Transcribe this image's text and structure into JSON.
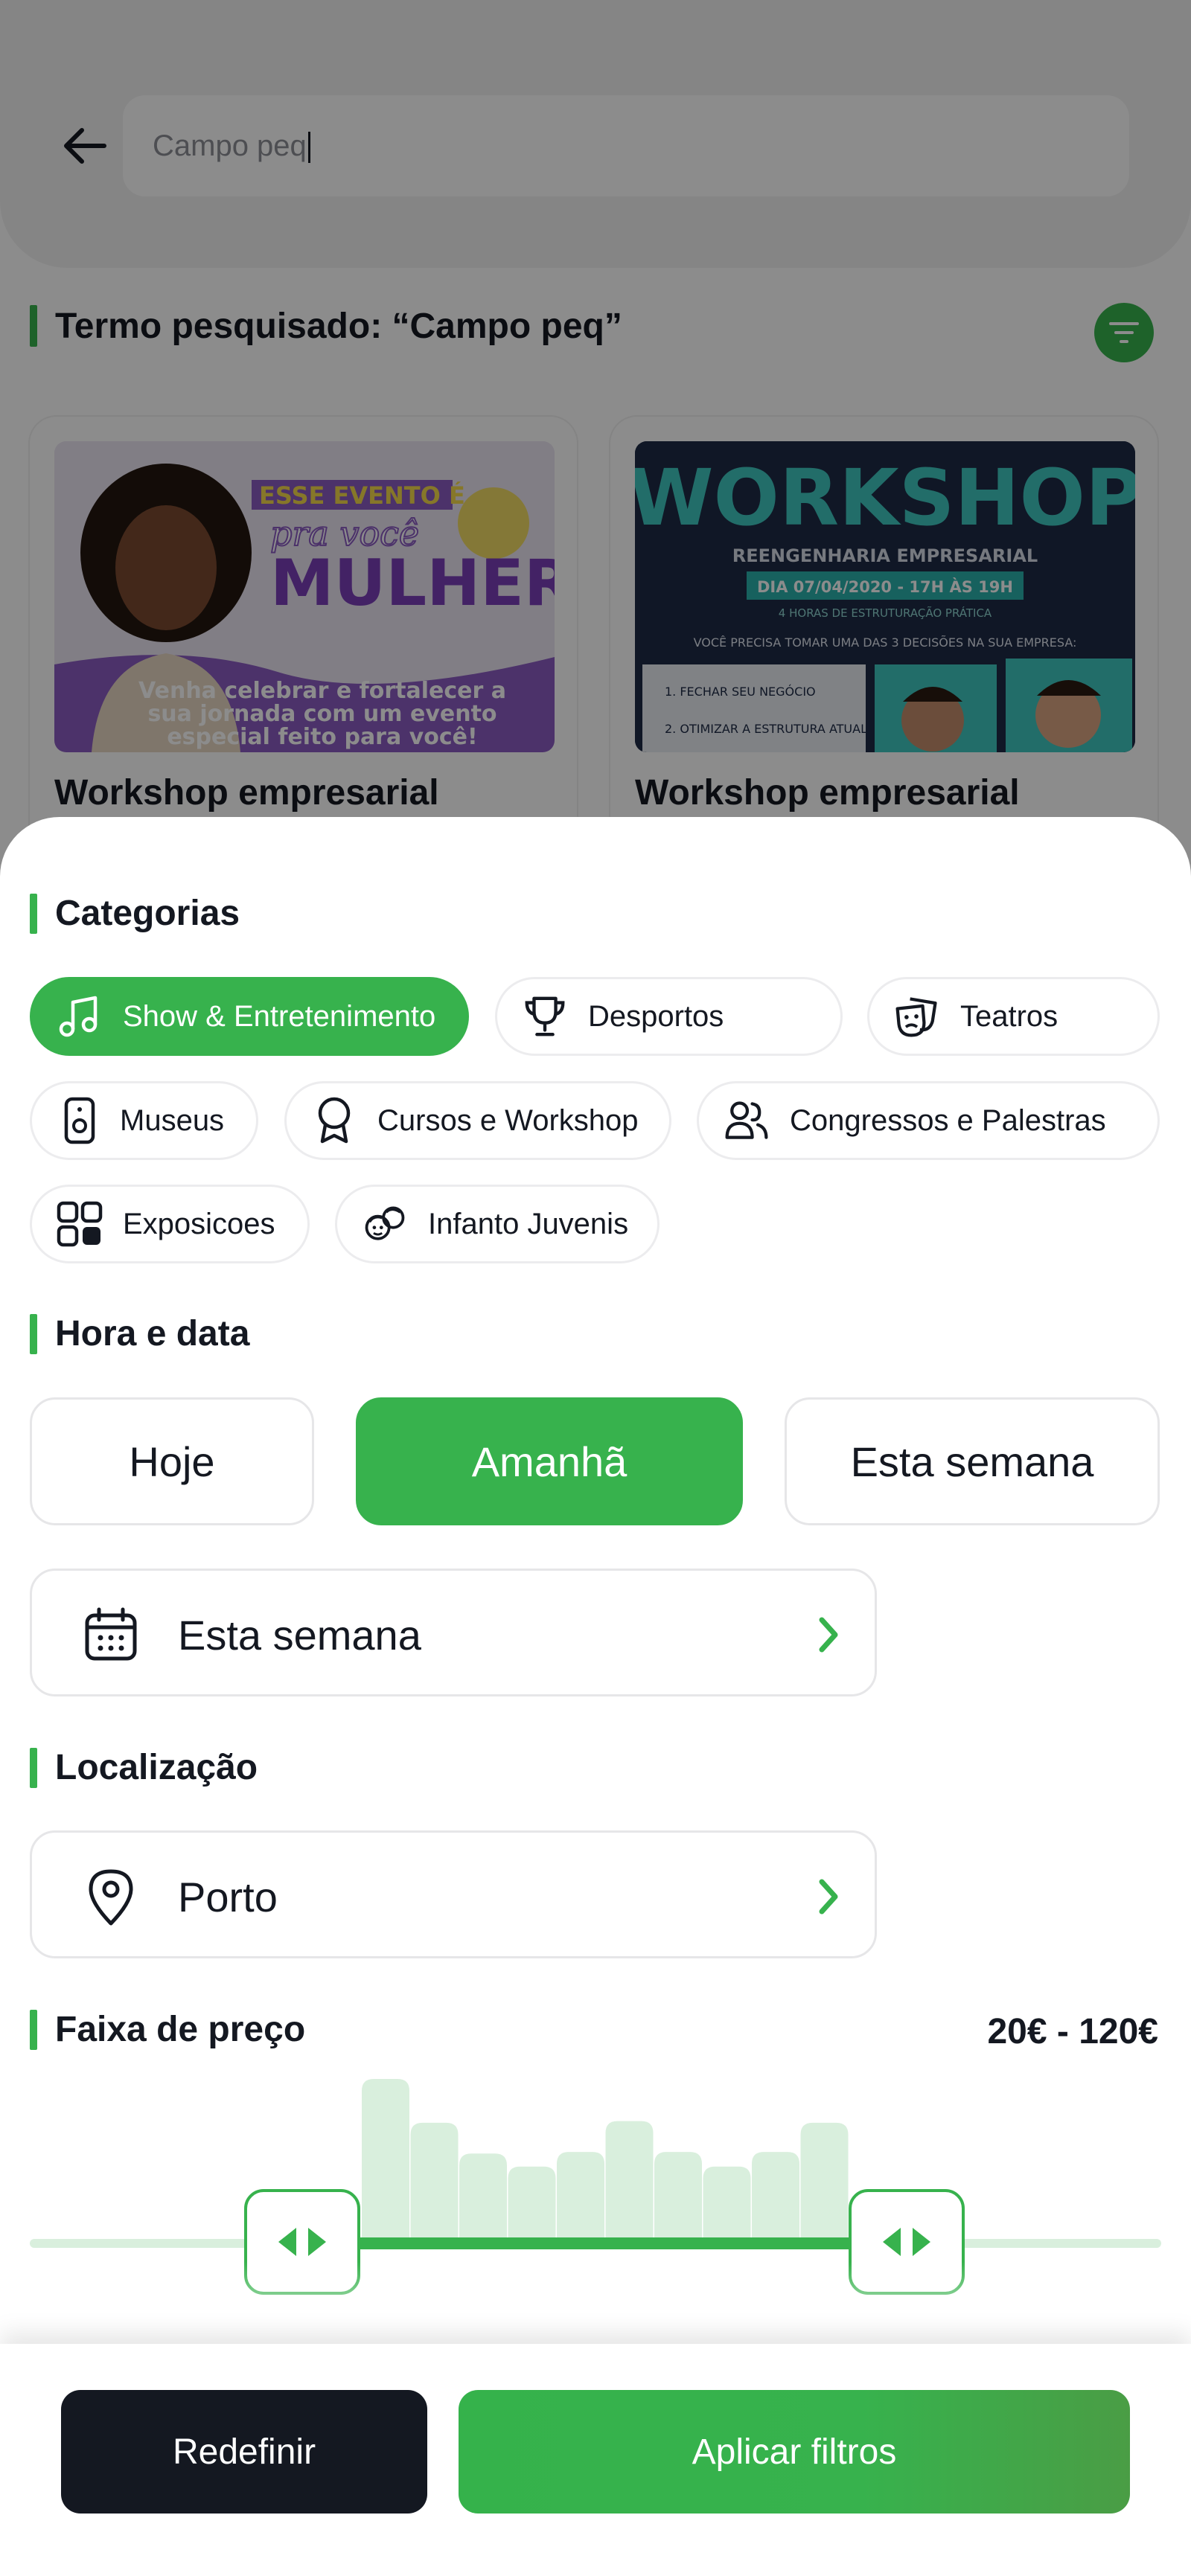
{
  "search": {
    "value": "Campo peq"
  },
  "results": {
    "heading": "Termo pesquisado: “Campo peq”",
    "cards": [
      {
        "title": "Workshop empresarial",
        "image_text": {
          "line1": "ESSE EVENTO É",
          "line2": "pra você",
          "line3": "MULHER",
          "caption": "Venha celebrar e fortalecer a sua jornada com um evento especial feito para você!"
        }
      },
      {
        "title": "Workshop empresarial",
        "image_text": {
          "headline": "WORKSHOP",
          "subtitle": "REENGENHARIA EMPRESARIAL",
          "date": "DIA 07/04/2020 - 17H ÀS 19H",
          "note": "4 HORAS DE ESTRUTURAÇÃO PRÁTICA",
          "question": "VOCÊ PRECISA TOMAR UMA DAS 3 DECISÕES NA SUA EMPRESA:",
          "item1": "1. FECHAR SEU NEGÓCIO",
          "item2": "2. OTIMIZAR A ESTRUTURA ATUAL"
        }
      }
    ]
  },
  "filters": {
    "categories": {
      "title": "Categorias",
      "items": [
        {
          "label": "Show & Entretenimento",
          "icon": "music-note-icon",
          "active": true
        },
        {
          "label": "Desportos",
          "icon": "trophy-icon",
          "active": false
        },
        {
          "label": "Teatros",
          "icon": "theater-masks-icon",
          "active": false
        },
        {
          "label": "Museus",
          "icon": "speaker-icon",
          "active": false
        },
        {
          "label": "Cursos e Workshop",
          "icon": "award-ribbon-icon",
          "active": false
        },
        {
          "label": "Congressos e Palestras",
          "icon": "people-icon",
          "active": false
        },
        {
          "label": "Exposicoes",
          "icon": "grid-icon",
          "active": false
        },
        {
          "label": "Infanto Juvenis",
          "icon": "kids-icon",
          "active": false
        }
      ]
    },
    "datetime": {
      "title": "Hora e data",
      "options": [
        {
          "label": "Hoje",
          "active": false
        },
        {
          "label": "Amanhã",
          "active": true
        },
        {
          "label": "Esta semana",
          "active": false
        }
      ],
      "picker_value": "Esta semana"
    },
    "location": {
      "title": "Localização",
      "value": "Porto"
    },
    "price": {
      "title": "Faixa de preço",
      "range_text": "20€ - 120€",
      "histogram_relative_heights": [
        1.0,
        0.73,
        0.54,
        0.46,
        0.55,
        0.74,
        0.55,
        0.46,
        0.55,
        0.73
      ]
    }
  },
  "actions": {
    "reset_label": "Redefinir",
    "apply_label": "Aplicar filtros"
  },
  "colors": {
    "accent": "#37b24d",
    "dark": "#141821",
    "histogram": "#d9efdd"
  }
}
